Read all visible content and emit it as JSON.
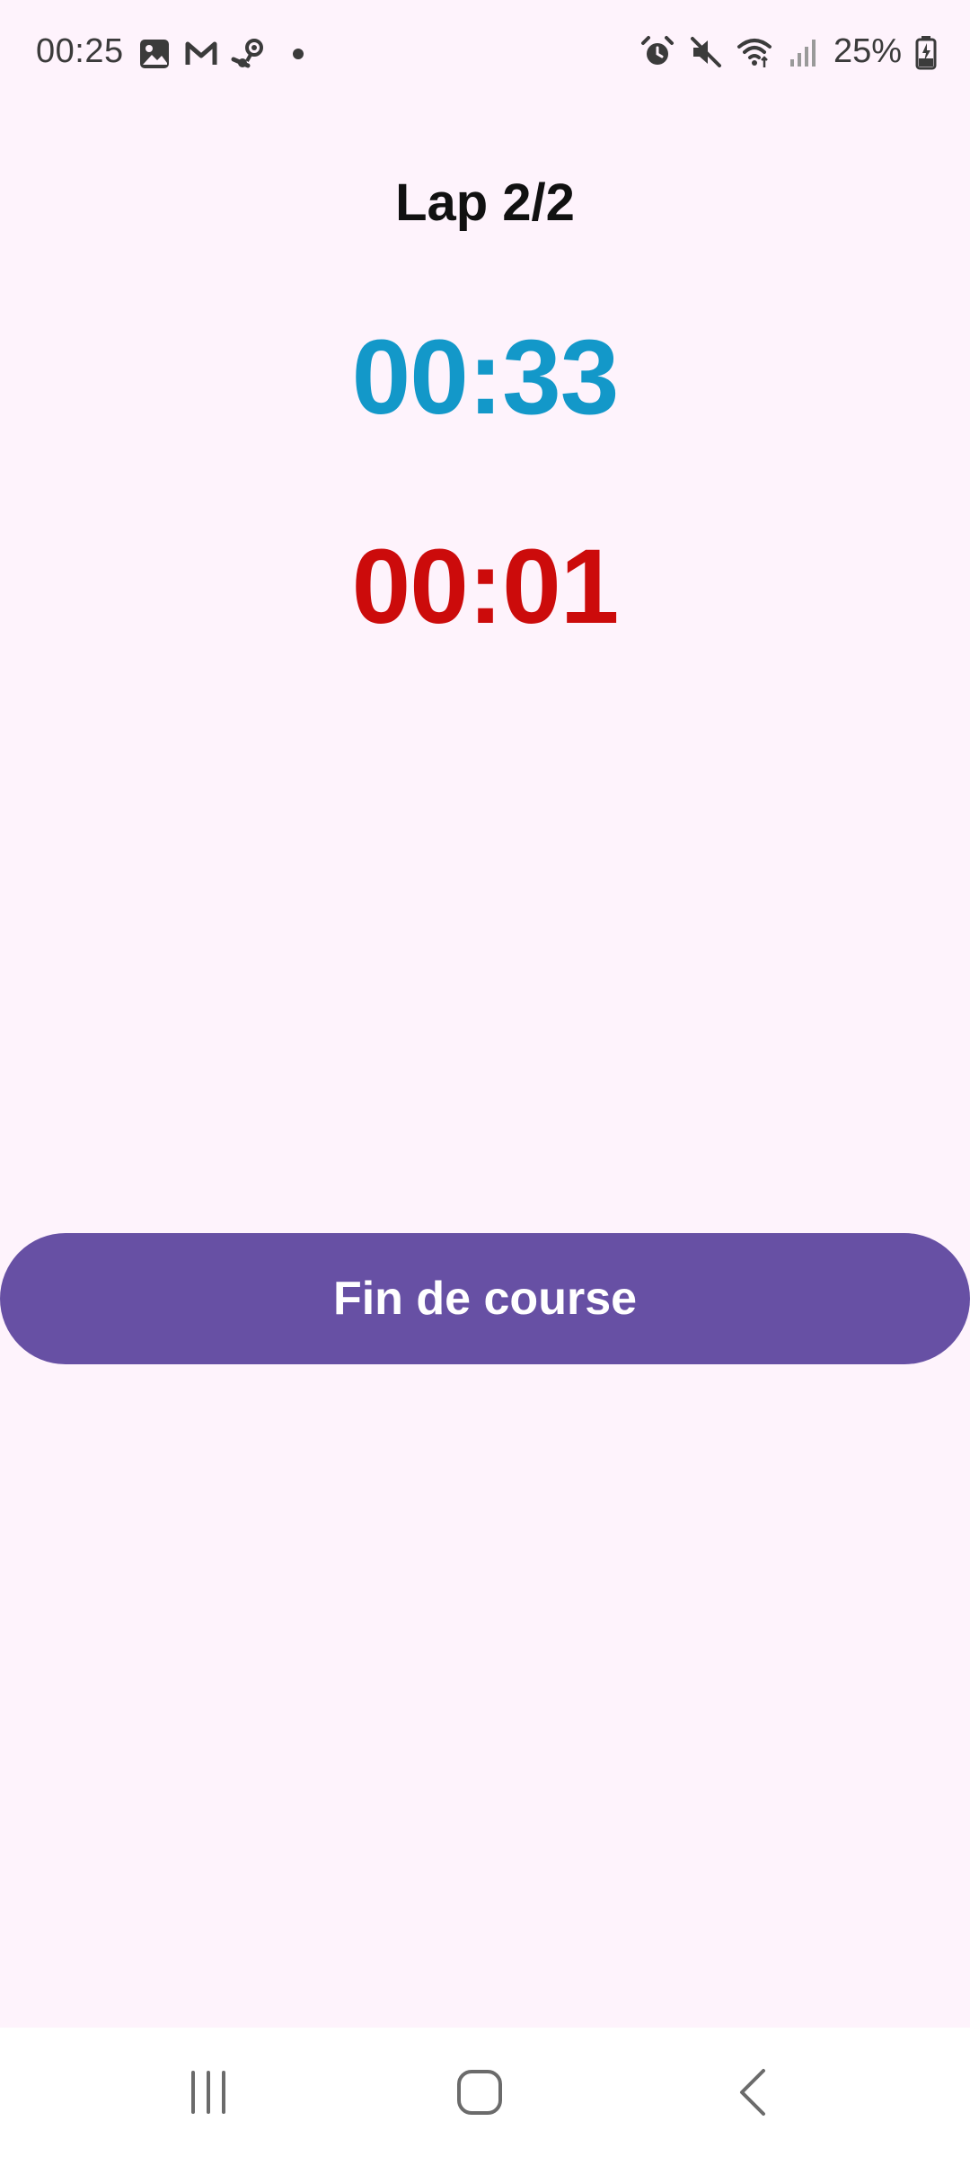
{
  "status_bar": {
    "time": "00:25",
    "battery_percent": "25%",
    "left_icons": [
      "gallery-icon",
      "gmail-icon",
      "steam-icon",
      "notification-dot-icon"
    ],
    "right_icons": [
      "alarm-icon",
      "mute-icon",
      "wifi-icon",
      "signal-icon",
      "battery-charging-icon"
    ]
  },
  "main": {
    "lap_label": "Lap 2/2",
    "total_time": "00:33",
    "lap_time": "00:01",
    "end_button_label": "Fin de course"
  },
  "colors": {
    "background": "#fef3fc",
    "total_time": "#1398c9",
    "lap_time": "#cc0b0b",
    "button": "#6750a4"
  },
  "nav_bar": {
    "buttons": [
      "recents-icon",
      "home-icon",
      "back-icon"
    ]
  }
}
